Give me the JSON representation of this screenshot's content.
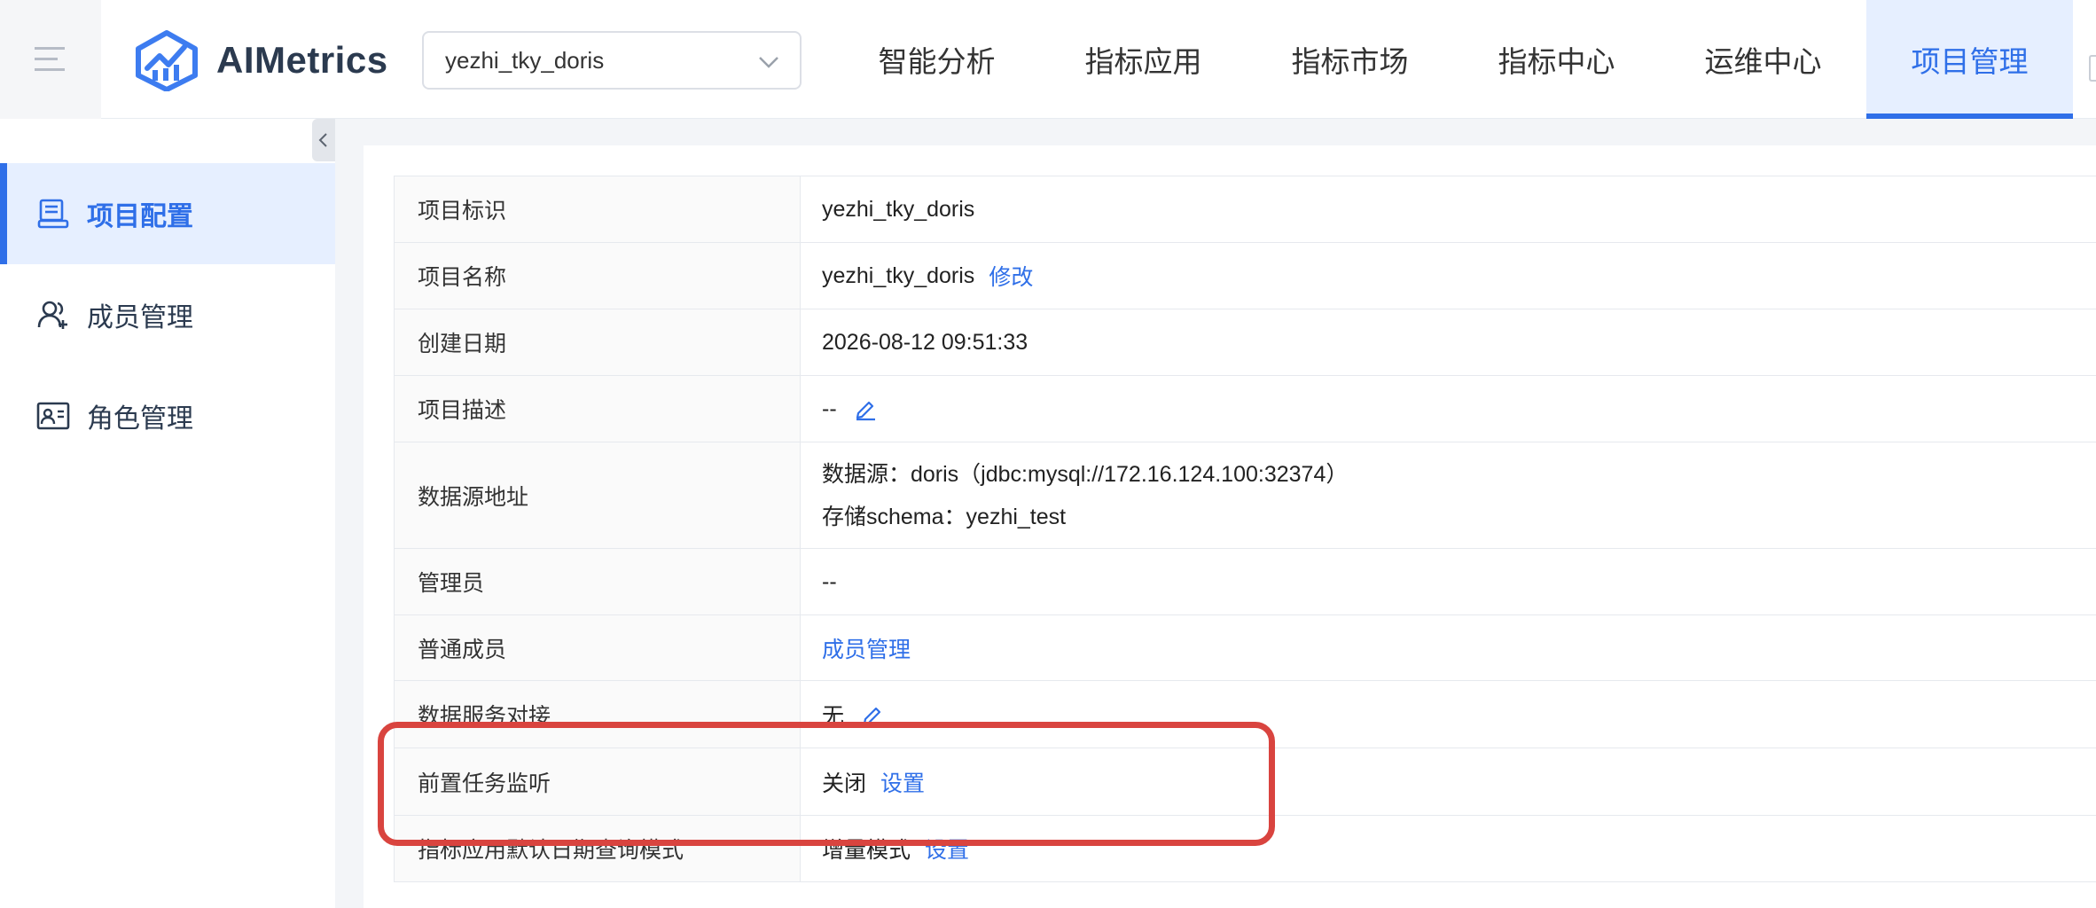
{
  "header": {
    "app_name": "AIMetrics",
    "project_select": {
      "value": "yezhi_tky_doris"
    },
    "nav": [
      {
        "label": "智能分析",
        "active": false
      },
      {
        "label": "指标应用",
        "active": false
      },
      {
        "label": "指标市场",
        "active": false
      },
      {
        "label": "指标中心",
        "active": false
      },
      {
        "label": "运维中心",
        "active": false
      },
      {
        "label": "项目管理",
        "active": true
      }
    ]
  },
  "sidebar": {
    "items": [
      {
        "label": "项目配置",
        "icon": "project-config-icon",
        "active": true
      },
      {
        "label": "成员管理",
        "icon": "members-icon",
        "active": false
      },
      {
        "label": "角色管理",
        "icon": "role-card-icon",
        "active": false
      }
    ]
  },
  "project_info": {
    "rows": [
      {
        "label": "项目标识",
        "value": "yezhi_tky_doris"
      },
      {
        "label": "项目名称",
        "value": "yezhi_tky_doris",
        "link": "修改"
      },
      {
        "label": "创建日期",
        "value": "2026-08-12 09:51:33"
      },
      {
        "label": "项目描述",
        "value": "--"
      },
      {
        "label": "数据源地址",
        "line1": "数据源：doris（jdbc:mysql://172.16.124.100:32374）",
        "line2": "存储schema：yezhi_test"
      },
      {
        "label": "管理员",
        "value": "--"
      },
      {
        "label": "普通成员",
        "link": "成员管理"
      },
      {
        "label": "数据服务对接",
        "value": "无"
      },
      {
        "label": "前置任务监听",
        "value": "关闭",
        "link": "设置"
      },
      {
        "label": "指标应用默认日期查询模式",
        "value": "增量模式",
        "link": "设置"
      }
    ]
  },
  "colors": {
    "accent": "#2f6fe8",
    "highlight": "#d9443f",
    "active_bg": "#e6efff"
  }
}
